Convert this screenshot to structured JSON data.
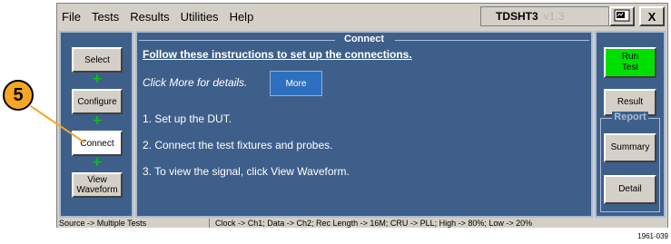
{
  "menu": [
    "File",
    "Tests",
    "Results",
    "Utilities",
    "Help"
  ],
  "product": {
    "name": "TDSHT3",
    "version": "v1.3"
  },
  "window_buttons": {
    "close": "X",
    "app_icon": "app-icon"
  },
  "nav": {
    "select": "Select",
    "configure": "Configure",
    "connect": "Connect",
    "view_line1": "View",
    "view_line2": "Waveform",
    "active": "Connect"
  },
  "main": {
    "title": "Connect",
    "heading": "Follow these instructions to set up the connections.",
    "hint": "Click More for details.",
    "more_label": "More",
    "steps": [
      "1. Set up the DUT.",
      "2. Connect the test fixtures and probes.",
      "3. To view the signal, click View Waveform."
    ]
  },
  "right": {
    "run_line1": "Run",
    "run_line2": "Test",
    "result": "Result",
    "report_label": "Report",
    "summary": "Summary",
    "detail": "Detail"
  },
  "status": {
    "source": "Source -> Multiple Tests",
    "config": "Clock -> Ch1; Data -> Ch2; Rec Length -> 16M; CRU -> PLL; High -> 80%; Low -> 20%"
  },
  "callout": {
    "number": "5"
  },
  "figure_id": "1961-039",
  "colors": {
    "panel_bg": "#3e5f8a",
    "panel_border": "#a9bcd6",
    "run_button": "#00e000",
    "more_button": "#2f6fbf",
    "callout": "#f5a623",
    "nav_arrow": "#00cc00"
  }
}
